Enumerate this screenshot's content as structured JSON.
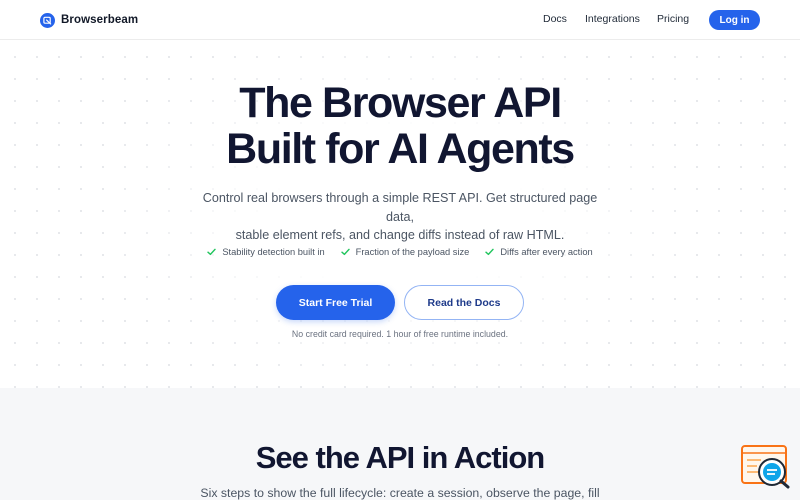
{
  "nav": {
    "brand": "Browserbeam",
    "links": [
      "Docs",
      "Integrations",
      "Pricing"
    ],
    "login_label": "Log in"
  },
  "hero": {
    "title_line1": "The Browser API",
    "title_line2": "Built for AI Agents",
    "subtitle_line1": "Control real browsers through a simple REST API. Get structured page data,",
    "subtitle_line2": "stable element refs, and change diffs instead of raw HTML.",
    "features": [
      "Stability detection built in",
      "Fraction of the payload size",
      "Diffs after every action"
    ],
    "primary_cta": "Start Free Trial",
    "secondary_cta": "Read the Docs",
    "note": "No credit card required. 1 hour of free runtime included."
  },
  "section2": {
    "title": "See the API in Action",
    "subtitle": "Six steps to show the full lifecycle: create a session, observe the page, fill"
  },
  "colors": {
    "accent": "#2563eb",
    "check": "#22c55e",
    "heading": "#111631",
    "chat_widget": "#f97316"
  },
  "icons": {
    "brand": "browser-logo-icon",
    "feature": "check-icon",
    "chat": "chat-widget-icon"
  }
}
